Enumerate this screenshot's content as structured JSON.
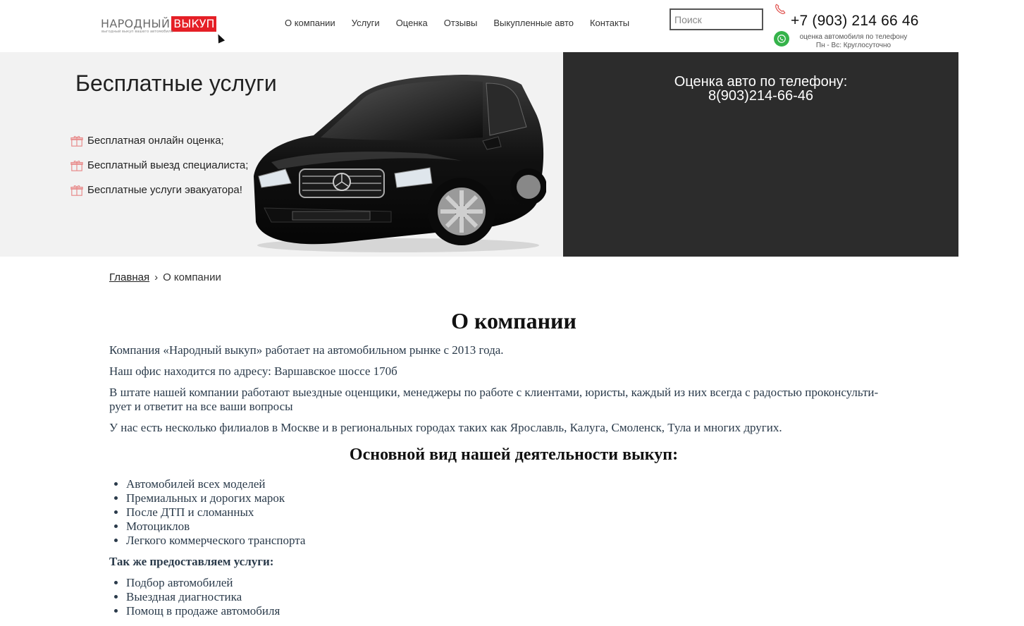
{
  "header": {
    "logo": {
      "part1": "НАРОДНЫЙ",
      "part2": "ВЫКУП",
      "tagline": "выгодный выкуп вашего автомобиля"
    },
    "nav": [
      "О компании",
      "Услуги",
      "Оценка",
      "Отзывы",
      "Выкупленные авто",
      "Контакты"
    ],
    "search_placeholder": "Поиск",
    "phone": "+7 (903) 214 66 46",
    "phone_sub1": "оценка автомобиля по телефону",
    "phone_sub2": "Пн - Вс: Круглосуточно",
    "icons": {
      "phone": "phone-icon",
      "whatsapp": "whatsapp-icon"
    },
    "colors": {
      "brand_red": "#e51f26",
      "whatsapp_green": "#35b34a"
    }
  },
  "hero": {
    "title": "Бесплатные услуги",
    "items": [
      "Бесплатная онлайн оценка;",
      "Бесплатный выезд специалиста;",
      "Бесплатные услуги эвакуатора!"
    ],
    "right_line1": "Оценка авто по телефону:",
    "right_line2": "8(903)214-66-46",
    "colors": {
      "left_bg": "#f2f2f2",
      "right_bg": "#2c2c2c"
    }
  },
  "breadcrumb": {
    "home": "Главная",
    "sep": "›",
    "current": "О компании"
  },
  "content": {
    "title": "О компании",
    "paragraphs": [
      "Компания «Народный выкуп» работает на автомобильном рынке с 2013 года.",
      "Наш офис находится по адресу: Варшавское шоссе 170б",
      "В штате нашей компании работают выездные оценщики, менеджеры по работе с клиентами, юристы, каждый из них всегда с радостью проконсульти-руетиответит на все ваши вопросы",
      "У нас есть несколько филиалов в Москве и в региональных городах таких как Ярославль, Калуга, Смоленск, Тула и многих других."
    ],
    "p3_line1": "В штате нашей компании работают выездные оценщики, менеджеры по работе с клиентами, юристы, каждый из них всегда с радостью проконсульти-",
    "p3_line2": "рует и ответит на все ваши вопросы",
    "subtitle": "Основной вид нашей деятельности выкуп:",
    "list1": [
      "Автомобилей всех моделей",
      "Премиальных и дорогих марок",
      "После ДТП и сломанных",
      "Мотоциклов",
      "Легкого коммерческого транспорта"
    ],
    "bold_line": "Так же предоставляем услуги:",
    "list2": [
      "Подбор автомобилей",
      "Выездная диагностика",
      "Помощ в продаже автомобиля"
    ]
  }
}
